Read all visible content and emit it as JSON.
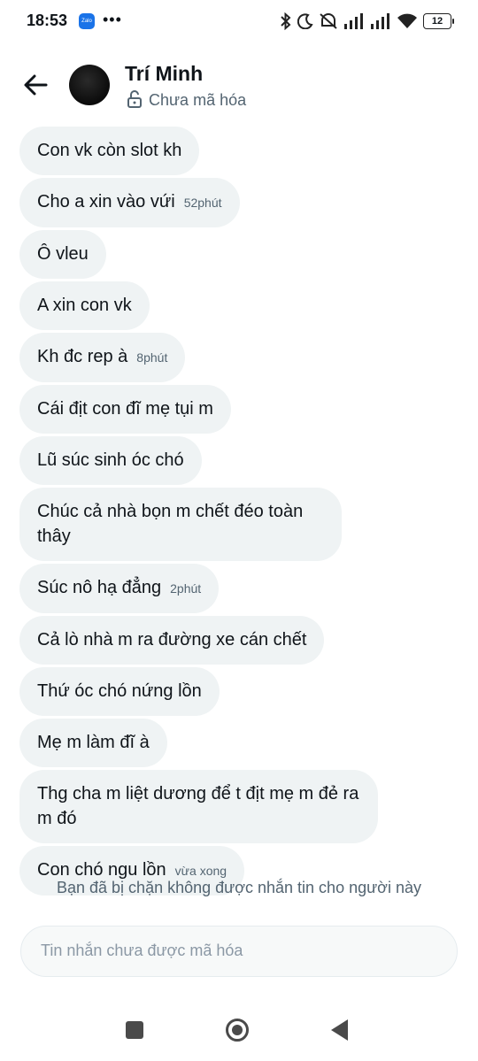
{
  "status_bar": {
    "time": "18:53",
    "app_icon": "zalo-icon",
    "app_icon_text": "Zalo",
    "battery": "12"
  },
  "header": {
    "contact_name": "Trí Minh",
    "encryption_status": "Chưa mã hóa"
  },
  "messages": [
    {
      "text": "Con vk còn slot kh",
      "time": ""
    },
    {
      "text": "Cho a xin vào vứi",
      "time": "52phút"
    },
    {
      "text": "Ô vleu",
      "time": ""
    },
    {
      "text": "A xin con vk",
      "time": ""
    },
    {
      "text": "Kh đc rep à",
      "time": "8phút"
    },
    {
      "text": "Cái địt con đĩ mẹ tụi m",
      "time": ""
    },
    {
      "text": "Lũ súc sinh óc chó",
      "time": ""
    },
    {
      "text": "Chúc cả nhà bọn m chết đéo toàn thây",
      "time": ""
    },
    {
      "text": "Súc nô hạ đẳng",
      "time": "2phút"
    },
    {
      "text": "Cả lò nhà m ra đường xe cán chết",
      "time": ""
    },
    {
      "text": "Thứ óc chó nứng lồn",
      "time": ""
    },
    {
      "text": "Mẹ m làm đĩ à",
      "time": ""
    },
    {
      "text": "Thg cha m liệt dương để t địt mẹ m đẻ ra m đó",
      "time": ""
    },
    {
      "text": "Con chó ngu lồn",
      "time": "vừa xong"
    }
  ],
  "blocked_notice": "Bạn đã bị chặn không được nhắn tin cho người này",
  "composer": {
    "placeholder": "Tin nhắn chưa được mã hóa"
  },
  "colors": {
    "bubble_bg": "#eff3f4",
    "secondary_text": "#536471"
  }
}
